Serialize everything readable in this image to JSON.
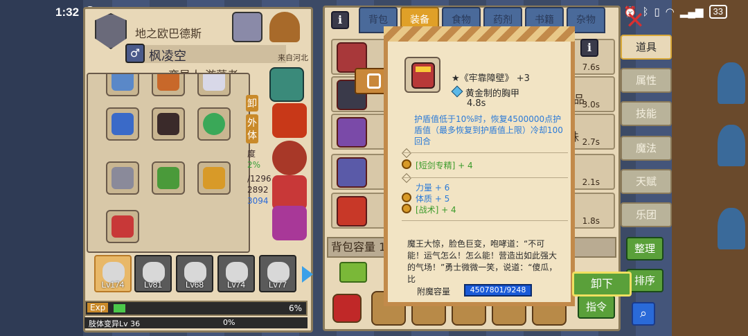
{
  "status_bar": {
    "time": "1:32",
    "battery": "33"
  },
  "character": {
    "guild_name": "地之欧巴德斯",
    "gender_symbol": "♂",
    "name": "枫凌空",
    "origin": "来自河北",
    "job": "变异人 游荡者",
    "side_tags": [
      "卸",
      "外",
      "体"
    ],
    "stat_fragments": [
      "度",
      "2%",
      "/1296",
      "2892",
      "3094"
    ],
    "portraits": [
      {
        "level": "Lv174",
        "active": true
      },
      {
        "level": "Lv81",
        "active": false
      },
      {
        "level": "Lv68",
        "active": false
      },
      {
        "level": "Lv74",
        "active": false
      },
      {
        "level": "Lv77",
        "active": false
      }
    ],
    "exp_label": "Exp",
    "exp_percent": "6%",
    "exp_fraction": 0.06,
    "mutation_label": "肢体变异Lv 36",
    "mutation_percent": "0%"
  },
  "inventory": {
    "tabs": [
      {
        "label": "背包",
        "active": false
      },
      {
        "label": "装备",
        "active": true
      },
      {
        "label": "食物",
        "active": false
      },
      {
        "label": "药剂",
        "active": false
      },
      {
        "label": "书籍",
        "active": false
      },
      {
        "label": "杂物",
        "active": false
      }
    ],
    "rows": [
      {
        "time": "7.6s",
        "name": ""
      },
      {
        "time": "3.0s",
        "name": "的活祭品"
      },
      {
        "time": "2.7s",
        "name": "珠"
      },
      {
        "time": "2.1s",
        "name": ""
      },
      {
        "time": "1.8s",
        "name": ""
      }
    ],
    "capacity_label": "背包容量 18",
    "capacity_tail": "s"
  },
  "sidebar": {
    "tabs": [
      {
        "label": "道具",
        "active": true
      },
      {
        "label": "属性",
        "active": false
      },
      {
        "label": "技能",
        "active": false
      },
      {
        "label": "魔法",
        "active": false
      },
      {
        "label": "天赋",
        "active": false
      },
      {
        "label": "乐团",
        "active": false
      }
    ],
    "sort_label": "整理",
    "order_label": "排序",
    "command_label": "指令"
  },
  "tooltip": {
    "item_name": "★《牢靠障壁》 +3",
    "item_type": "黄金制的胸甲",
    "item_time": "4.8s",
    "effect": "护盾值低于10%时，恢复4500000点护盾值（最多恢复到护盾值上限）冷却100回合",
    "skill_bonus": "[短剑专精] + 4",
    "stat_strength": "力量 + 6",
    "stat_constitution": "体质 + 5",
    "stat_tactics": "[战术] + 4",
    "flavor": "魔王大惊，脸色巨变，咆哮道：“不可能！运气怎么！怎么能！营造出如此强大的气场！”勇士微微一笑，说道：“傻瓜，比",
    "enchant_label": "附魔容量",
    "enchant_value": "4507801/9248",
    "unequip_label": "卸下",
    "info_symbol": "i"
  },
  "colors": {
    "accent_orange": "#e0a028",
    "effect_blue": "#2a7ad8",
    "bonus_green": "#3a9a2a",
    "button_green": "#5aa03a"
  }
}
